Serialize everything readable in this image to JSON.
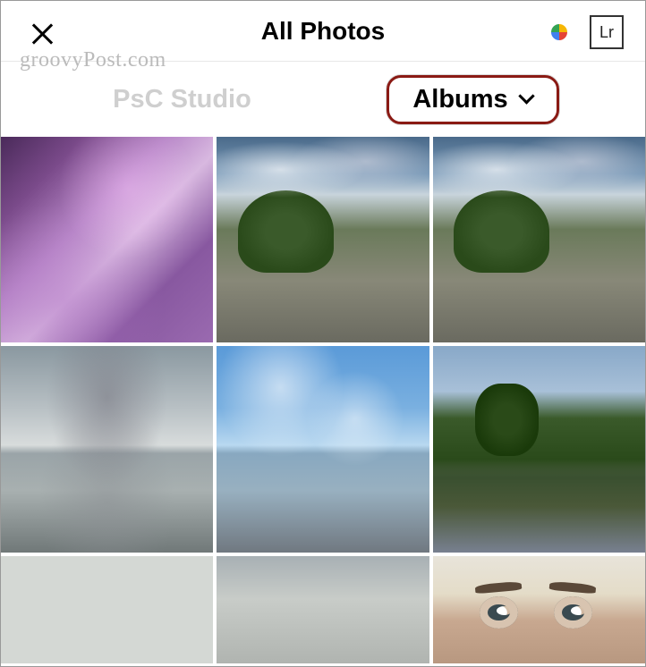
{
  "header": {
    "title": "All Photos",
    "lr_label": "Lr"
  },
  "watermark": "groovyPost.com",
  "tabs": {
    "psc_label": "PsC Studio",
    "albums_label": "Albums"
  },
  "thumbnails": [
    {
      "name": "photo-purple-abstract"
    },
    {
      "name": "photo-street-trees-1"
    },
    {
      "name": "photo-street-trees-2"
    },
    {
      "name": "photo-lake-cloudy"
    },
    {
      "name": "photo-lake-bluesky"
    },
    {
      "name": "photo-river-greenery"
    },
    {
      "name": "photo-grey-1"
    },
    {
      "name": "photo-grey-2"
    },
    {
      "name": "photo-selfie"
    }
  ]
}
